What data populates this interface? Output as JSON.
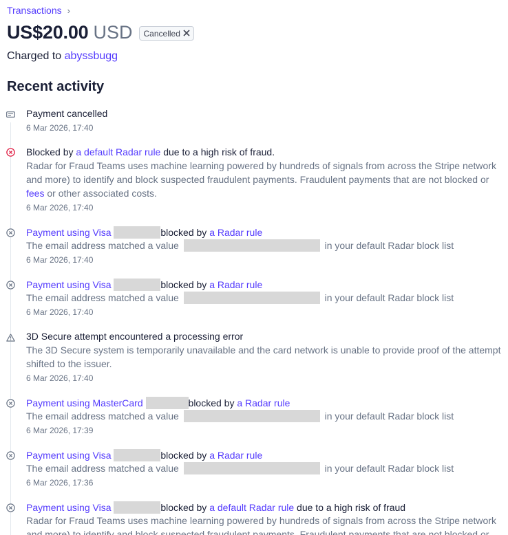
{
  "breadcrumb": {
    "label": "Transactions",
    "chevron": "›"
  },
  "payment": {
    "amount": "US$20.00",
    "currency": "USD",
    "status": "Cancelled",
    "charged_prefix": "Charged to",
    "customer": "abyssbugg"
  },
  "activity_title": "Recent activity",
  "events": [
    {
      "icon": "payment-card-icon",
      "title": "Payment cancelled",
      "ts": "6 Mar 2026, 17:40"
    },
    {
      "icon": "error-circle-icon",
      "title_pre": "Blocked by ",
      "title_link": "a default Radar rule",
      "title_post": " due to a high risk of fraud.",
      "desc1": "Radar for Fraud Teams uses machine learning powered by hundreds of signals from across the Stripe network",
      "desc2": "and more) to identify and block suspected fraudulent payments. Fraudulent payments that are not blocked or",
      "desc3_link": "fees",
      "desc3_post": " or other associated costs.",
      "ts": "6 Mar 2026, 17:40"
    },
    {
      "icon": "blocked-circle-icon",
      "title_link": "Payment using Visa",
      "title_mid": "blocked by ",
      "title_link2": "a Radar rule",
      "desc_pre": "The email address matched a value",
      "desc_post": "in your default Radar block list",
      "ts": "6 Mar 2026, 17:40"
    },
    {
      "icon": "blocked-circle-icon",
      "title_link": "Payment using Visa",
      "title_mid": "blocked by ",
      "title_link2": "a Radar rule",
      "desc_pre": "The email address matched a value",
      "desc_post": "in your default Radar block list",
      "ts": "6 Mar 2026, 17:40"
    },
    {
      "icon": "warning-triangle-icon",
      "title": "3D Secure attempt encountered a processing error",
      "desc1": "The 3D Secure system is temporarily unavailable and the card network is unable to provide proof of the attempt",
      "desc2": "shifted to the issuer.",
      "ts": "6 Mar 2026, 17:40"
    },
    {
      "icon": "blocked-circle-icon",
      "title_link": "Payment using MasterCard",
      "title_mid": "blocked by ",
      "title_link2": "a Radar rule",
      "desc_pre": "The email address matched a value",
      "desc_post": "in your default Radar block list",
      "ts": "6 Mar 2026, 17:39"
    },
    {
      "icon": "blocked-circle-icon",
      "title_link": "Payment using Visa",
      "title_mid": "blocked by ",
      "title_link2": "a Radar rule",
      "desc_pre": "The email address matched a value",
      "desc_post": "in your default Radar block list",
      "ts": "6 Mar 2026, 17:36"
    },
    {
      "icon": "blocked-circle-icon",
      "title_link": "Payment using Visa",
      "title_mid": "blocked by ",
      "title_link2": "a default Radar rule",
      "title_post": " due to a high risk of fraud",
      "desc1": "Radar for Fraud Teams uses machine learning powered by hundreds of signals from across the Stripe network",
      "desc2": "and more) to identify and block suspected fraudulent payments. Fraudulent payments that are not blocked or"
    }
  ],
  "colors": {
    "link": "#533afd",
    "error": "#df1b41",
    "muted": "#687385",
    "text": "#1a1f36",
    "redaction": "#d8d8d8"
  }
}
